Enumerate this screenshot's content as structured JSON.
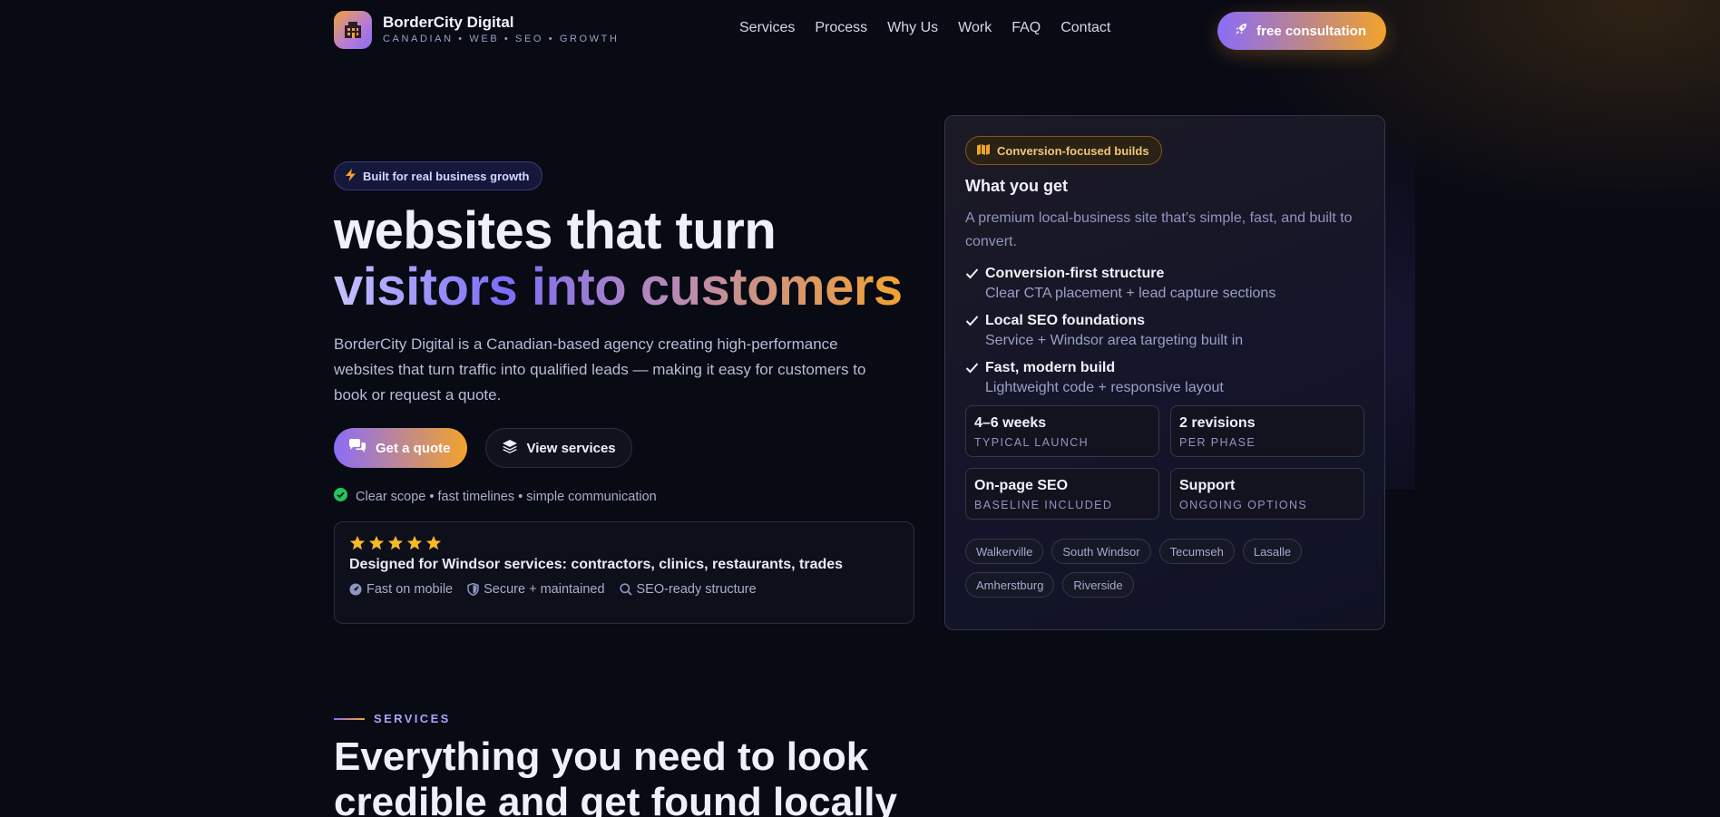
{
  "brand": {
    "name": "BorderCity Digital",
    "tagline": "CANADIAN • WEB • SEO • GROWTH"
  },
  "nav": {
    "links": [
      "Services",
      "Process",
      "Why Us",
      "Work",
      "FAQ",
      "Contact"
    ],
    "cta": "free consultation"
  },
  "hero": {
    "pill": "Built for real business growth",
    "headline_line1": "websites that turn",
    "headline_line2": "visitors into customers",
    "lead": "BorderCity Digital is a Canadian-based agency creating high-performance websites that turn traffic into qualified leads — making it easy for customers to book or request a quote.",
    "primary_button": "Get a quote",
    "secondary_button": "View services",
    "assurance": "Clear scope • fast timelines • simple communication"
  },
  "trust_card": {
    "stars": 5,
    "title": "Designed for Windsor services: contractors, clinics, restaurants, trades",
    "features": [
      "Fast on mobile",
      "Secure + maintained",
      "SEO-ready structure"
    ]
  },
  "panel": {
    "pill": "Conversion-focused builds",
    "title": "What you get",
    "subtitle": "A premium local-business site that’s simple, fast, and built to convert.",
    "checks": [
      {
        "title": "Conversion-first structure",
        "desc": "Clear CTA placement + lead capture sections"
      },
      {
        "title": "Local SEO foundations",
        "desc": "Service + Windsor area targeting built in"
      },
      {
        "title": "Fast, modern build",
        "desc": "Lightweight code + responsive layout"
      }
    ],
    "stats": [
      {
        "value": "4–6 weeks",
        "label": "TYPICAL LAUNCH"
      },
      {
        "value": "2 revisions",
        "label": "PER PHASE"
      },
      {
        "value": "On-page SEO",
        "label": "BASELINE INCLUDED"
      },
      {
        "value": "Support",
        "label": "ONGOING OPTIONS"
      }
    ],
    "areas": [
      "Walkerville",
      "South Windsor",
      "Tecumseh",
      "Lasalle",
      "Amherstburg",
      "Riverside"
    ]
  },
  "services": {
    "eyebrow": "SERVICES",
    "title": "Everything you need to look credible and get found locally"
  },
  "colors": {
    "background": "#080a14",
    "accent_purple": "#8b6cf7",
    "accent_orange": "#f2a32c",
    "star": "#f6b928",
    "success": "#22c55e"
  }
}
